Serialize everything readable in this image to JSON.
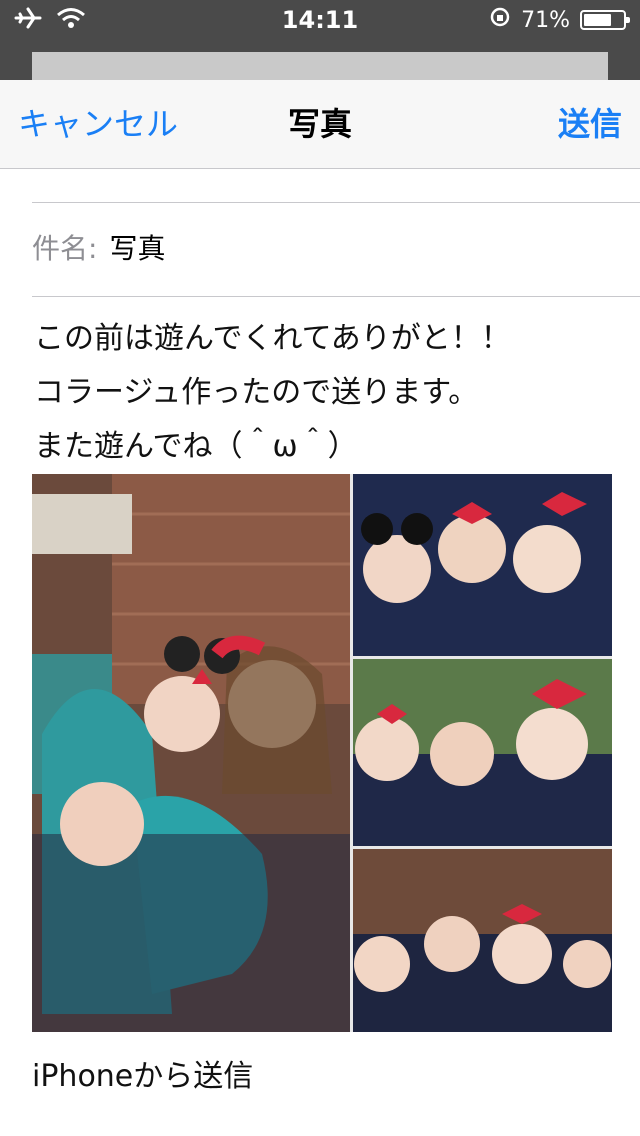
{
  "status_bar": {
    "time": "14:11",
    "battery_percent": "71%",
    "battery_level": 0.71,
    "icons": [
      "airplane-icon",
      "wifi-icon",
      "rotation-lock-icon",
      "battery-icon"
    ]
  },
  "nav": {
    "cancel_label": "キャンセル",
    "title": "写真",
    "send_label": "送信"
  },
  "compose": {
    "subject_label": "件名:",
    "subject_value": "写真",
    "body_lines": [
      "この前は遊んでくれてありがと！！",
      "コラージュ作ったので送ります。",
      "また遊んでね（＾ω＾）"
    ],
    "signature": "iPhoneから送信"
  },
  "colors": {
    "accent": "#1a7ff5",
    "status_bar_bg": "#4a4a4a",
    "nav_bg": "#f7f7f7"
  }
}
